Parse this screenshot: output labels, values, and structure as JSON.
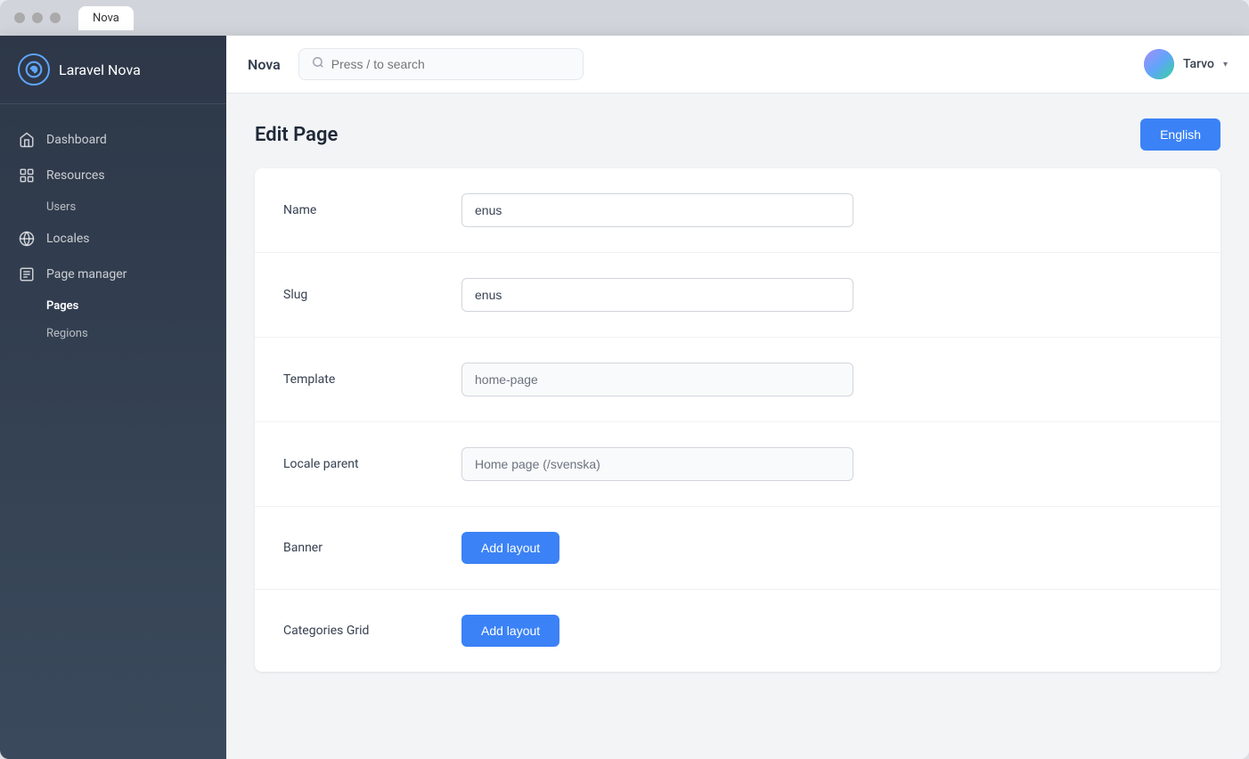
{
  "app": {
    "name": "Laravel",
    "name_suffix": " Nova"
  },
  "browser": {
    "tab_label": "Nova"
  },
  "header": {
    "nova_label": "Nova",
    "search_placeholder": "Press / to search",
    "user_name": "Tarvo"
  },
  "sidebar": {
    "logo_text": "Laravel",
    "logo_suffix": " Nova",
    "items": [
      {
        "id": "dashboard",
        "label": "Dashboard"
      },
      {
        "id": "resources",
        "label": "Resources"
      },
      {
        "id": "locales",
        "label": "Locales"
      },
      {
        "id": "page-manager",
        "label": "Page manager"
      }
    ],
    "sub_items": {
      "resources": [
        {
          "id": "users",
          "label": "Users",
          "active": false
        }
      ],
      "page-manager": [
        {
          "id": "pages",
          "label": "Pages",
          "active": true
        },
        {
          "id": "regions",
          "label": "Regions",
          "active": false
        }
      ]
    }
  },
  "page": {
    "title": "Edit Page",
    "language_button": "English"
  },
  "form": {
    "fields": [
      {
        "id": "name",
        "label": "Name",
        "value": "enus",
        "type": "input",
        "disabled": false
      },
      {
        "id": "slug",
        "label": "Slug",
        "value": "enus",
        "type": "input",
        "disabled": false
      },
      {
        "id": "template",
        "label": "Template",
        "value": "home-page",
        "type": "input",
        "disabled": true
      },
      {
        "id": "locale-parent",
        "label": "Locale parent",
        "value": "Home page (/svenska)",
        "type": "input",
        "disabled": true
      },
      {
        "id": "banner",
        "label": "Banner",
        "type": "button",
        "button_label": "Add layout"
      },
      {
        "id": "categories-grid",
        "label": "Categories Grid",
        "type": "button",
        "button_label": "Add layout"
      }
    ]
  },
  "icons": {
    "search": "🔍",
    "dashboard": "⌂",
    "resources": "⊞",
    "locales": "🌐",
    "page_manager": "📄",
    "chevron_down": "▾",
    "logo_spiral": "◎"
  }
}
